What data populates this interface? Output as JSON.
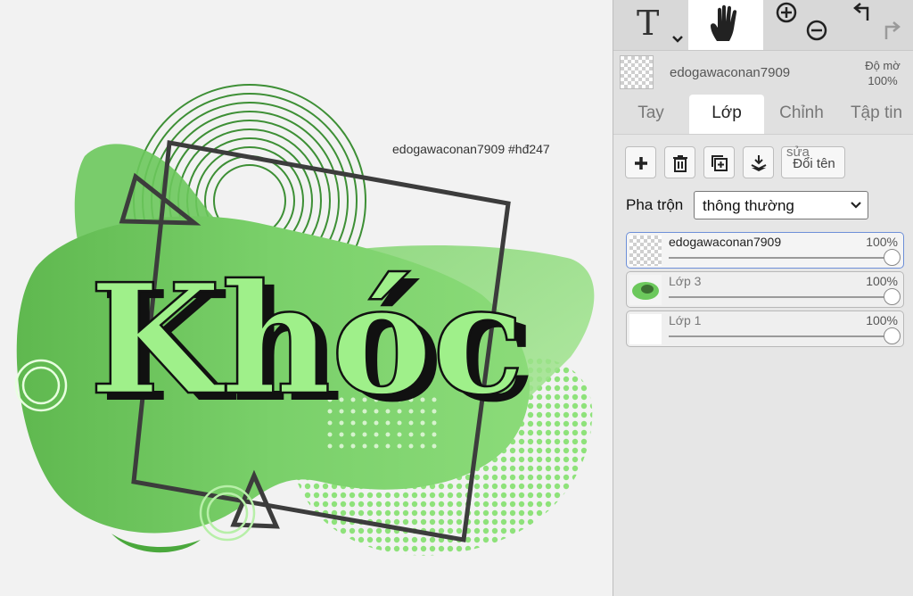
{
  "canvas": {
    "watermark": "edogawaconan7909   #hđ247",
    "title_text": "Khóc",
    "colors": {
      "green_main": "#6dc85a",
      "green_light": "#9be38a",
      "dark_frame": "#3c3c3c"
    }
  },
  "toolbar": {
    "tools": [
      {
        "name": "text-tool",
        "label": "T",
        "icon": "text-icon"
      },
      {
        "name": "hand-tool",
        "icon": "hand-icon",
        "active": true
      },
      {
        "name": "zoom-tool",
        "icon": "zoom-in-out-icon"
      },
      {
        "name": "undo-redo",
        "icon": "undo-redo-icon"
      }
    ]
  },
  "layer_header": {
    "name": "edogawaconan7909",
    "opacity_label": "Độ mờ",
    "opacity_value": "100%"
  },
  "tabs": [
    {
      "label": "Tay"
    },
    {
      "label": "Lớp",
      "active": true
    },
    {
      "label": "Chỉnh"
    },
    {
      "label": "Tập tin"
    }
  ],
  "layer_buttons": {
    "rename_label": "Đổi tên",
    "rename_ghost": "sửa"
  },
  "blend": {
    "label": "Pha trộn",
    "selected": "thông thường"
  },
  "layers": [
    {
      "name": "edogawaconan7909",
      "opacity": "100%",
      "opacity_value": 1.0,
      "active": true
    },
    {
      "name": "Lớp 3",
      "opacity": "100%",
      "opacity_value": 1.0
    },
    {
      "name": "Lớp 1",
      "opacity": "100%",
      "opacity_value": 1.0
    }
  ]
}
